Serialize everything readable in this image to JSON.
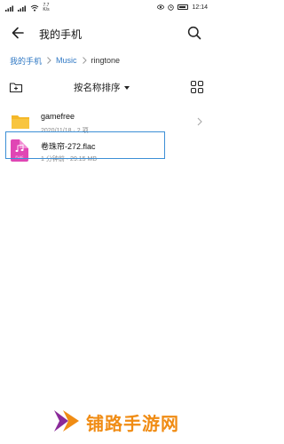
{
  "status_bar": {
    "net_speed_top": "7.7",
    "net_speed_bottom": "K/s",
    "time": "12:14"
  },
  "app_bar": {
    "title": "我的手机"
  },
  "breadcrumb": {
    "items": [
      "我的手机",
      "Music",
      "ringtone"
    ]
  },
  "toolbar": {
    "sort_label": "按名称排序"
  },
  "files": [
    {
      "name": "gamefree",
      "meta": "2020/11/18 · 2 项",
      "type": "folder"
    },
    {
      "name": "卷珠帘-272.flac",
      "meta": "1 分钟前 · 29.15 MB",
      "type": "flac",
      "icon_label": "FLAC"
    }
  ],
  "watermark": {
    "text": "铺路手游网"
  },
  "colors": {
    "accent": "#2f78c4",
    "folder": "#f5b829",
    "flac": "#e046b4",
    "selection": "#3c8fd6",
    "watermark": "#f08c14"
  }
}
